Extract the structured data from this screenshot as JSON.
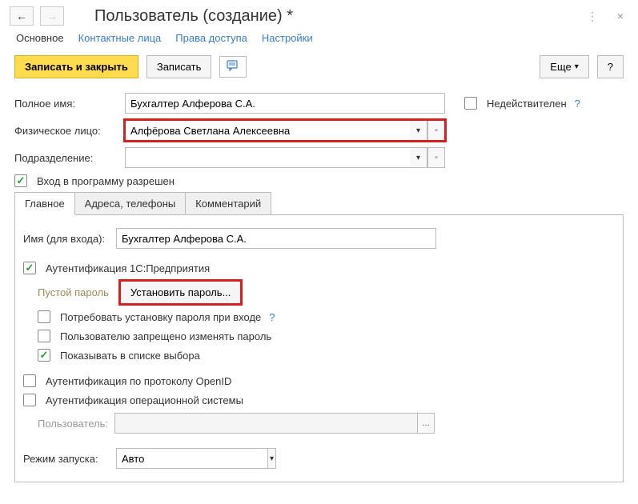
{
  "window": {
    "title": "Пользователь (создание) *"
  },
  "nav": {
    "items": [
      "Основное",
      "Контактные лица",
      "Права доступа",
      "Настройки"
    ],
    "active": 0
  },
  "toolbar": {
    "save_close": "Записать и закрыть",
    "save": "Записать",
    "more": "Еще",
    "help": "?"
  },
  "fields": {
    "fullname_label": "Полное имя:",
    "fullname_value": "Бухгалтер Алферова С.А.",
    "inactive_label": "Недействителен",
    "person_label": "Физическое лицо:",
    "person_value": "Алфёрова Светлана Алексеевна",
    "dept_label": "Подразделение:",
    "dept_value": "",
    "login_allowed_label": "Вход в программу разрешен"
  },
  "subtabs": [
    "Главное",
    "Адреса, телефоны",
    "Комментарий"
  ],
  "main": {
    "login_label": "Имя (для входа):",
    "login_value": "Бухгалтер Алферова С.А.",
    "auth1c_label": "Аутентификация 1С:Предприятия",
    "pwd_empty": "Пустой пароль",
    "set_pwd": "Установить пароль...",
    "require_pwd_change": "Потребовать установку пароля при входе",
    "deny_pwd_change": "Пользователю запрещено изменять пароль",
    "show_in_list": "Показывать в списке выбора",
    "auth_openid": "Аутентификация по протоколу OpenID",
    "auth_os": "Аутентификация операционной системы",
    "os_user_label": "Пользователь:",
    "os_user_value": "",
    "launch_mode_label": "Режим запуска:",
    "launch_mode_value": "Авто"
  }
}
